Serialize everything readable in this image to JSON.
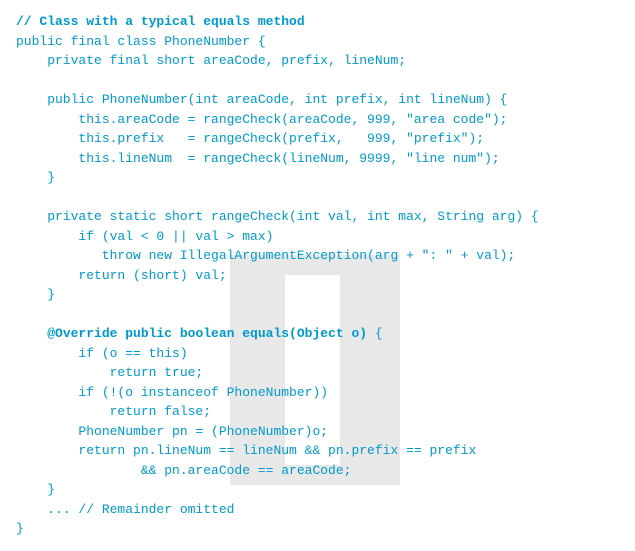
{
  "code": {
    "l01": "// Class with a typical equals method",
    "l02": "public final class PhoneNumber {",
    "l03": "    private final short areaCode, prefix, lineNum;",
    "l04": "",
    "l05": "    public PhoneNumber(int areaCode, int prefix, int lineNum) {",
    "l06": "        this.areaCode = rangeCheck(areaCode, 999, \"area code\");",
    "l07": "        this.prefix   = rangeCheck(prefix,   999, \"prefix\");",
    "l08": "        this.lineNum  = rangeCheck(lineNum, 9999, \"line num\");",
    "l09": "    }",
    "l10": "",
    "l11": "    private static short rangeCheck(int val, int max, String arg) {",
    "l12": "        if (val < 0 || val > max)",
    "l13": "           throw new IllegalArgumentException(arg + \": \" + val);",
    "l14": "        return (short) val;",
    "l15": "    }",
    "l16": "",
    "l17a": "    ",
    "l17b": "@Override public boolean equals(Object o)",
    "l17c": " {",
    "l18": "        if (o == this)",
    "l19": "            return true;",
    "l20": "        if (!(o instanceof PhoneNumber))",
    "l21": "            return false;",
    "l22": "        PhoneNumber pn = (PhoneNumber)o;",
    "l23": "        return pn.lineNum == lineNum && pn.prefix == prefix",
    "l24": "                && pn.areaCode == areaCode;",
    "l25": "    }",
    "l26": "    ... // Remainder omitted",
    "l27": "}"
  }
}
